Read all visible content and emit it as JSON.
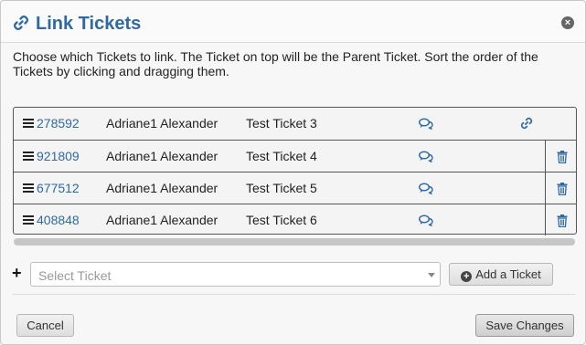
{
  "dialog": {
    "title": "Link Tickets",
    "close_symbol": "×",
    "instructions": "Choose which Tickets to link. The Ticket on top will be the Parent Ticket. Sort the order of the Tickets by clicking and dragging them."
  },
  "tickets": [
    {
      "id": "278592",
      "owner": "Adriane1 Alexander",
      "name": "Test Ticket 3",
      "role_icon": "link-icon"
    },
    {
      "id": "921809",
      "owner": "Adriane1 Alexander",
      "name": "Test Ticket 4",
      "role_icon": "trash-icon"
    },
    {
      "id": "677512",
      "owner": "Adriane1 Alexander",
      "name": "Test Ticket 5",
      "role_icon": "trash-icon"
    },
    {
      "id": "408848",
      "owner": "Adriane1 Alexander",
      "name": "Test Ticket 6",
      "role_icon": "trash-icon"
    }
  ],
  "add_row": {
    "plus_symbol": "+",
    "select_placeholder": "Select Ticket",
    "add_button_label": "Add a Ticket",
    "add_button_symbol": "+"
  },
  "footer": {
    "cancel_label": "Cancel",
    "save_label": "Save Changes"
  },
  "colors": {
    "accent": "#2e6aa3",
    "border": "#555555"
  }
}
